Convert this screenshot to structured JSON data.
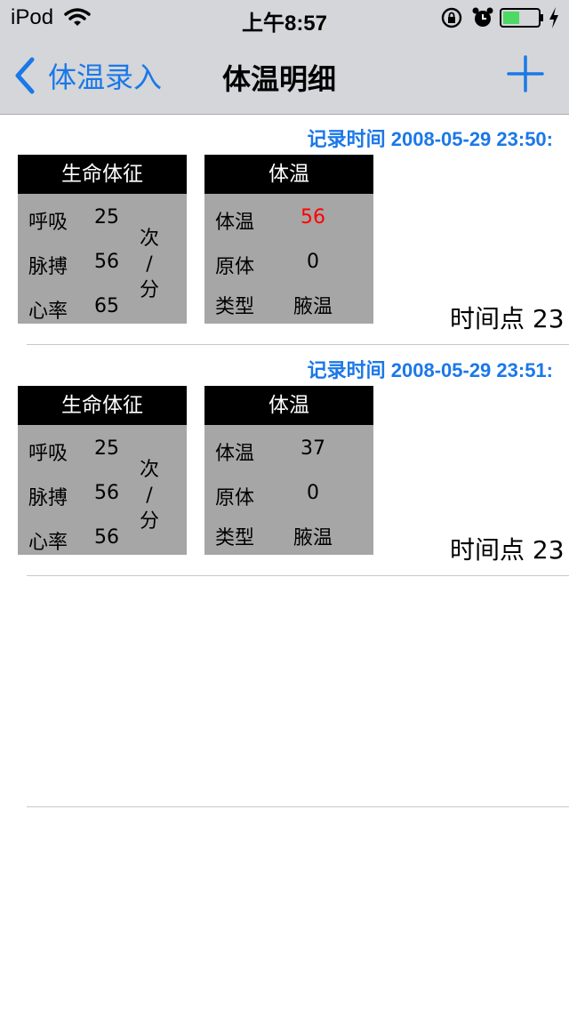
{
  "status_bar": {
    "carrier": "iPod",
    "time": "上午8:57",
    "battery_color": "#4cd964"
  },
  "nav": {
    "back_label": "体温录入",
    "title": "体温明细",
    "accent_color": "#1b78e8"
  },
  "records": [
    {
      "record_time": "记录时间 2008-05-29 23:50:",
      "vitals": {
        "header": "生命体征",
        "rows": [
          {
            "label": "呼吸",
            "value": "25"
          },
          {
            "label": "脉搏",
            "value": "56"
          },
          {
            "label": "心率",
            "value": "65"
          }
        ],
        "unit": [
          "次",
          "/",
          "分"
        ]
      },
      "temperature": {
        "header": "体温",
        "rows": [
          {
            "label": "体温",
            "value": "56",
            "value_color": "#ff0000"
          },
          {
            "label": "原体",
            "value": "0"
          },
          {
            "label": "类型",
            "value": "腋温"
          }
        ]
      },
      "timepoint": "时间点 23"
    },
    {
      "record_time": "记录时间 2008-05-29 23:51:",
      "vitals": {
        "header": "生命体征",
        "rows": [
          {
            "label": "呼吸",
            "value": "25"
          },
          {
            "label": "脉搏",
            "value": "56"
          },
          {
            "label": "心率",
            "value": "56"
          }
        ],
        "unit": [
          "次",
          "/",
          "分"
        ]
      },
      "temperature": {
        "header": "体温",
        "rows": [
          {
            "label": "体温",
            "value": "37"
          },
          {
            "label": "原体",
            "value": "0"
          },
          {
            "label": "类型",
            "value": "腋温"
          }
        ]
      },
      "timepoint": "时间点 23"
    }
  ]
}
